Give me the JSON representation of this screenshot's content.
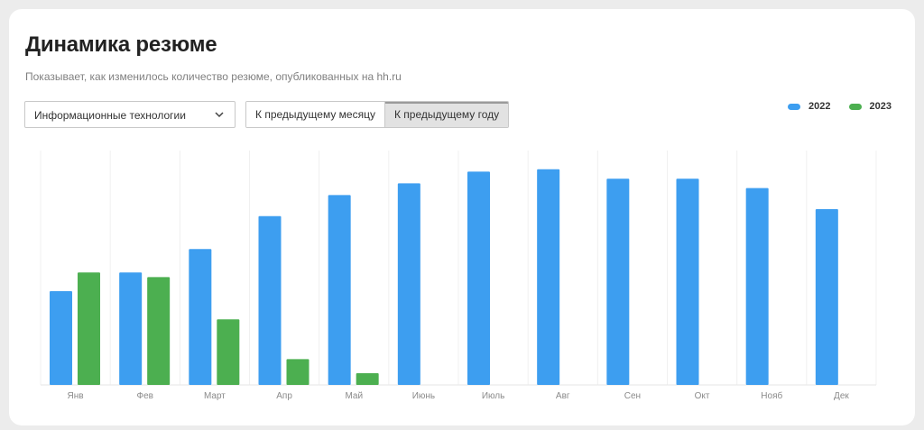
{
  "header": {
    "title": "Динамика резюме",
    "subtitle": "Показывает, как изменилось количество резюме, опубликованных на hh.ru"
  },
  "filters": {
    "category": "Информационные технологии",
    "icon": "chevron-down-icon",
    "compare_options": [
      "К предыдущему месяцу",
      "К предыдущему году"
    ],
    "selected_compare": "К предыдущему году"
  },
  "chart_data": {
    "type": "bar",
    "categories": [
      "Янв",
      "Фев",
      "Март",
      "Апр",
      "Май",
      "Июнь",
      "Июль",
      "Авг",
      "Сен",
      "Окт",
      "Нояб",
      "Дек"
    ],
    "series": [
      {
        "name": "2022",
        "color": "#3d9ef0",
        "values": [
          40,
          48,
          58,
          72,
          81,
          86,
          91,
          92,
          88,
          88,
          84,
          75
        ]
      },
      {
        "name": "2023",
        "color": "#4caf50",
        "values": [
          48,
          46,
          28,
          11,
          5,
          null,
          null,
          null,
          null,
          null,
          null,
          null
        ]
      }
    ],
    "ylim": [
      0,
      100
    ],
    "grid": "vertical",
    "legend": "top-right"
  }
}
